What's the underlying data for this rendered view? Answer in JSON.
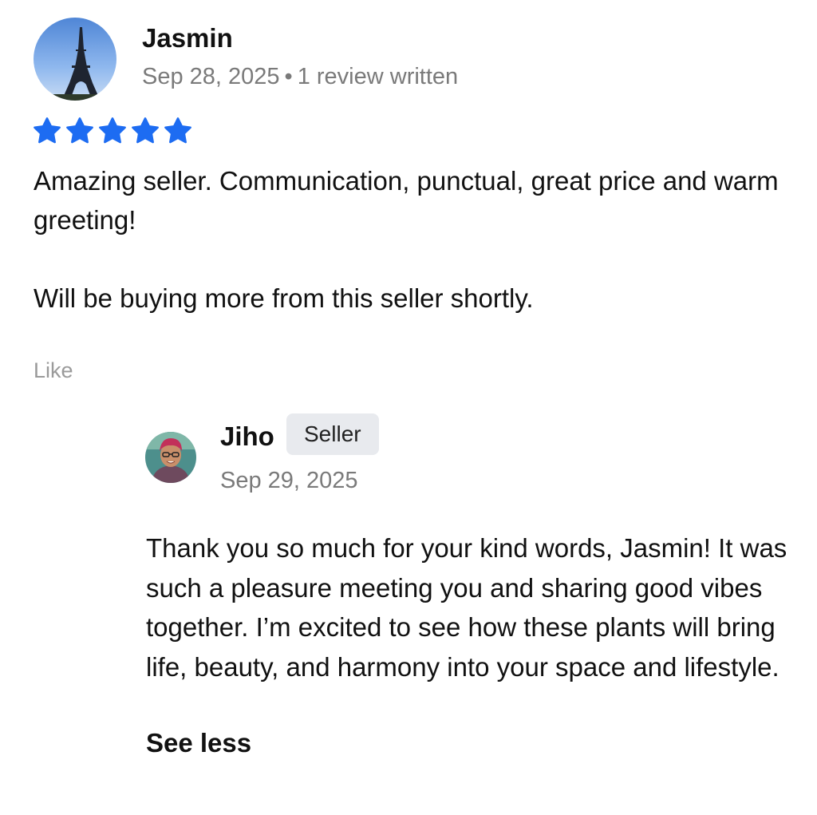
{
  "review": {
    "author": "Jasmin",
    "date": "Sep 28, 2025",
    "separator": "•",
    "review_count": "1 review written",
    "rating": 5,
    "star_color": "#1d6cf2",
    "paragraphs": [
      "Amazing seller.  Communication, punctual, great price and warm greeting!",
      "Will be buying more from this seller shortly."
    ],
    "like_label": "Like"
  },
  "reply": {
    "author": "Jiho",
    "badge": "Seller",
    "date": "Sep 29, 2025",
    "text": "Thank you so much for your kind words, Jasmin! It was such a pleasure meeting you and sharing good vibes together. I’m excited to see how these plants will bring life, beauty, and harmony into your space and lifestyle.",
    "toggle_label": "See less"
  },
  "colors": {
    "text": "#111111",
    "muted": "#7a7a7a",
    "like": "#9a9a9a",
    "badge_bg": "#e8eaee"
  }
}
